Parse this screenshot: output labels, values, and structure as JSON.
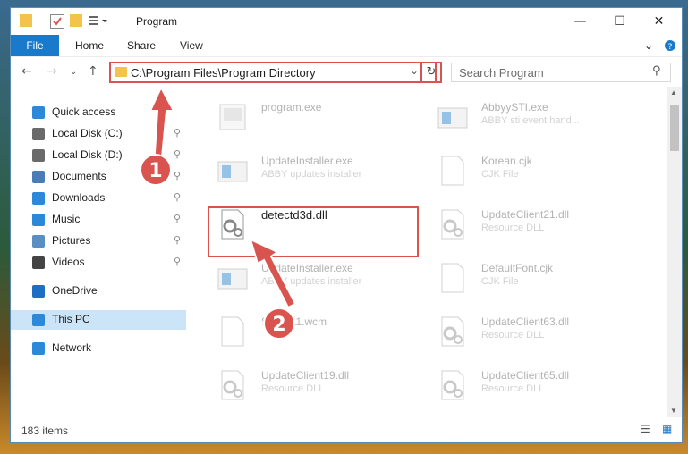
{
  "window": {
    "title": "Program",
    "controls": {
      "minimize": "—",
      "maximize": "☐",
      "close": "✕"
    }
  },
  "ribbon": {
    "tabs": [
      {
        "label": "File"
      },
      {
        "label": "Home"
      },
      {
        "label": "Share"
      },
      {
        "label": "View"
      }
    ]
  },
  "address": {
    "path": "C:\\Program Files\\Program Directory",
    "search_placeholder": "Search Program"
  },
  "sidebar": {
    "items": [
      {
        "label": "Quick access",
        "icon": "star-icon",
        "color": "#2c88d9"
      },
      {
        "label": "Local Disk (C:)",
        "icon": "drive-icon",
        "color": "#6a6a6a",
        "pinned": true
      },
      {
        "label": "Local Disk (D:)",
        "icon": "drive-icon",
        "color": "#6a6a6a",
        "pinned": true
      },
      {
        "label": "Documents",
        "icon": "documents-icon",
        "color": "#4a7db8",
        "pinned": true
      },
      {
        "label": "Downloads",
        "icon": "downloads-icon",
        "color": "#2c88d9",
        "pinned": true
      },
      {
        "label": "Music",
        "icon": "music-icon",
        "color": "#2c88d9",
        "pinned": true
      },
      {
        "label": "Pictures",
        "icon": "pictures-icon",
        "color": "#5a8fc4",
        "pinned": true
      },
      {
        "label": "Videos",
        "icon": "videos-icon",
        "color": "#444444",
        "pinned": true
      },
      {
        "label": "OneDrive",
        "icon": "onedrive-icon",
        "color": "#1e6fc4"
      },
      {
        "label": "This PC",
        "icon": "pc-icon",
        "color": "#2c88d9",
        "selected": true
      },
      {
        "label": "Network",
        "icon": "network-icon",
        "color": "#2c88d9"
      }
    ]
  },
  "files": [
    {
      "name": "program.exe",
      "desc": "",
      "icon": "exe-icon"
    },
    {
      "name": "AbbyySTI.exe",
      "desc": "ABBY sti event hand...",
      "icon": "app-icon"
    },
    {
      "name": "UpdateInstaller.exe",
      "desc": "ABBY updates installer",
      "icon": "app-icon"
    },
    {
      "name": "Korean.cjk",
      "desc": "CJK File",
      "icon": "blank-file-icon"
    },
    {
      "name": "detectd3d.dll",
      "desc": "",
      "icon": "dll-gear-icon"
    },
    {
      "name": "UpdateClient21.dll",
      "desc": "Resource DLL",
      "icon": "dll-gear-icon"
    },
    {
      "name": "UpdateInstaller.exe",
      "desc": "ABBY updates installer",
      "icon": "app-icon"
    },
    {
      "name": "DefaultFont.cjk",
      "desc": "CJK File",
      "icon": "blank-file-icon"
    },
    {
      "name": "Sp1IP11.wcm",
      "desc": "",
      "icon": "blank-file-icon"
    },
    {
      "name": "UpdateClient63.dll",
      "desc": "Resource DLL",
      "icon": "dll-gear-icon"
    },
    {
      "name": "UpdateClient19.dll",
      "desc": "Resource DLL",
      "icon": "dll-gear-icon"
    },
    {
      "name": "UpdateClient65.dll",
      "desc": "Resource DLL",
      "icon": "dll-gear-icon"
    }
  ],
  "status": {
    "item_count": "183 items"
  },
  "annotations": {
    "step1": "1",
    "step2": "2",
    "color": "#d9534f"
  }
}
